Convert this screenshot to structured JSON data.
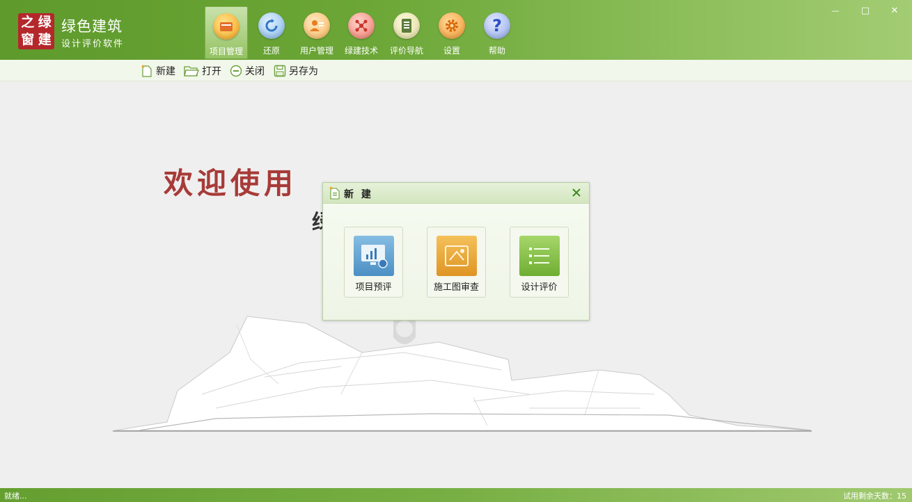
{
  "app": {
    "logo_chars": [
      "之",
      "绿",
      "窗",
      "建"
    ],
    "title": "绿色建筑",
    "subtitle": "设计评价软件"
  },
  "toolbar": {
    "items": [
      {
        "label": "项目管理",
        "icon": "folder-icon",
        "color": "#f5b92b",
        "active": true
      },
      {
        "label": "还原",
        "icon": "refresh-icon",
        "color": "#7fb6e8",
        "active": false
      },
      {
        "label": "用户管理",
        "icon": "user-icon",
        "color": "#f6b85d",
        "active": false
      },
      {
        "label": "绿建技术",
        "icon": "network-icon",
        "color": "#f07a6a",
        "active": false
      },
      {
        "label": "评价导航",
        "icon": "book-icon",
        "color": "#e8e4a8",
        "active": false
      },
      {
        "label": "设置",
        "icon": "gear-icon",
        "color": "#f29a2e",
        "active": false
      },
      {
        "label": "帮助",
        "icon": "help-icon",
        "color": "#8fa9ea",
        "active": false
      }
    ]
  },
  "window": {
    "minimize": "—",
    "maximize": "□",
    "close": "✕"
  },
  "subbar": {
    "items": [
      {
        "label": "新建",
        "icon": "new-file-icon"
      },
      {
        "label": "打开",
        "icon": "open-folder-icon"
      },
      {
        "label": "关闭",
        "icon": "close-circle-icon"
      },
      {
        "label": "另存为",
        "icon": "save-icon"
      }
    ]
  },
  "main": {
    "welcome": "欢迎使用",
    "welcome_sub": "绿"
  },
  "dialog": {
    "title": "新 建",
    "tiles": [
      {
        "label": "项目预评",
        "icon": "chart-monitor-icon",
        "color": "#5a9fd0"
      },
      {
        "label": "施工图审查",
        "icon": "blueprint-icon",
        "color": "#e9a93a"
      },
      {
        "label": "设计评价",
        "icon": "list-icon",
        "color": "#8cc448"
      }
    ]
  },
  "status": {
    "left": "就绪...",
    "right": "试用剩余天数：15"
  }
}
